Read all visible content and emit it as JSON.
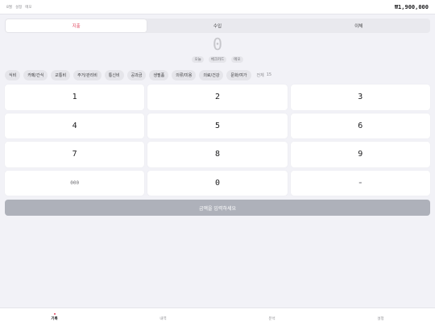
{
  "header": {
    "left_labels": [
      "8월",
      "설정",
      "메모"
    ],
    "balance": "₩1,900,000"
  },
  "type_tabs": [
    {
      "label": "지출",
      "active": true
    },
    {
      "label": "수입",
      "active": false
    },
    {
      "label": "이체",
      "active": false
    }
  ],
  "amount": {
    "value": "0",
    "date_label": "오늘",
    "method_label": "체크카드",
    "memo_label": "메모"
  },
  "categories": [
    "식비",
    "카페/간식",
    "교통비",
    "주거/관리비",
    "통신비",
    "공과금",
    "생필품",
    "의류/미용",
    "의료/건강",
    "문화/여가"
  ],
  "categories_all": {
    "label": "전체",
    "count": "15"
  },
  "keypad": {
    "keys": [
      "1",
      "2",
      "3",
      "4",
      "5",
      "6",
      "7",
      "8",
      "9",
      "000",
      "0",
      "="
    ]
  },
  "submit_label": "금액을 입력하세요",
  "colors": {
    "accent": "#e0405a",
    "submit_disabled": "#aeb1ba"
  },
  "tabbar": [
    {
      "label": "기록",
      "active": true
    },
    {
      "label": "내역",
      "active": false
    },
    {
      "label": "분석",
      "active": false
    },
    {
      "label": "설정",
      "active": false
    }
  ]
}
